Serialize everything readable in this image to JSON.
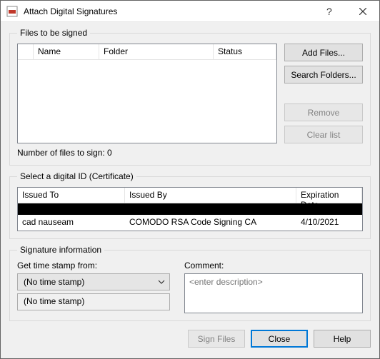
{
  "window": {
    "title": "Attach Digital Signatures"
  },
  "files_group": {
    "legend": "Files to be signed",
    "columns": {
      "name": "Name",
      "folder": "Folder",
      "status": "Status"
    },
    "buttons": {
      "add": "Add Files...",
      "search": "Search Folders...",
      "remove": "Remove",
      "clear": "Clear list"
    },
    "count_label": "Number of files to sign: 0"
  },
  "cert_group": {
    "legend": "Select a digital ID (Certificate)",
    "columns": {
      "issuedto": "Issued To",
      "issuedby": "Issued By",
      "exp": "Expiration Date"
    },
    "row": {
      "issuedto": "cad nauseam",
      "issuedby": "COMODO RSA Code Signing CA",
      "exp": "4/10/2021"
    }
  },
  "sig_group": {
    "legend": "Signature information",
    "timestamp_label": "Get time stamp from:",
    "timestamp_value": "(No time stamp)",
    "timestamp_readonly": "(No time stamp)",
    "comment_label": "Comment:",
    "comment_placeholder": "<enter description>"
  },
  "footer": {
    "sign": "Sign Files",
    "close": "Close",
    "help": "Help"
  }
}
